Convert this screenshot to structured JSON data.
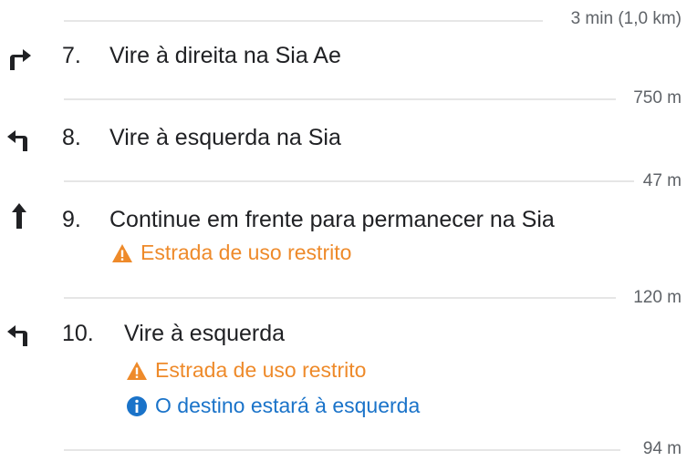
{
  "colors": {
    "warning": "#ee8a2a",
    "info": "#1a73c9",
    "divider": "#e6e6e6"
  },
  "header": {
    "duration": "3 min (1,0 km)"
  },
  "steps": [
    {
      "number": "7.",
      "icon": "turn-right-icon",
      "text": "Vire à direita na Sia Ae",
      "distance": "750 m"
    },
    {
      "number": "8.",
      "icon": "turn-left-icon",
      "text": "Vire à esquerda na Sia",
      "distance": "47 m"
    },
    {
      "number": "9.",
      "icon": "straight-arrow-icon",
      "text": "Continue em frente para permanecer na Sia",
      "notes": [
        {
          "icon": "warning-icon",
          "text": "Estrada de uso restrito"
        }
      ],
      "distance": "120 m"
    },
    {
      "number": "10.",
      "icon": "turn-left-icon",
      "text": "Vire à esquerda",
      "notes": [
        {
          "icon": "warning-icon",
          "text": "Estrada de uso restrito"
        },
        {
          "icon": "info-icon",
          "text": "O destino estará à esquerda"
        }
      ],
      "distance": "94 m"
    }
  ]
}
